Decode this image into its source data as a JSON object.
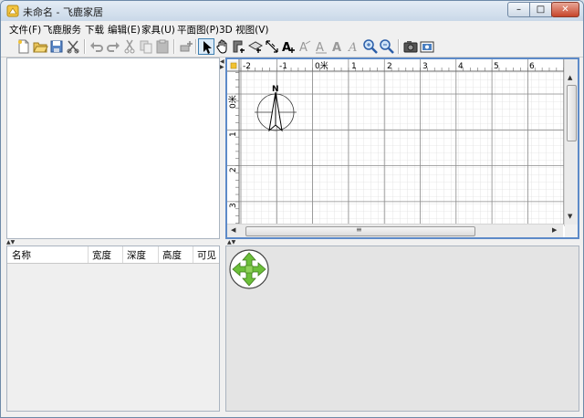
{
  "window": {
    "title": "未命名 - 飞鹿家居",
    "controls": {
      "minimize": "–",
      "maximize": "□",
      "close": "✕"
    }
  },
  "menu": [
    "文件(F)",
    "飞鹿服务",
    "下载",
    "编辑(E)",
    "家具(U)",
    "平面图(P)",
    "3D 视图(V)"
  ],
  "toolbar": {
    "icons": [
      "new-file-icon",
      "open-folder-icon",
      "save-icon",
      "cut-tools-icon",
      "undo-icon",
      "redo-icon",
      "cut-icon",
      "copy-icon",
      "paste-icon",
      "add-furniture-icon",
      "select-arrow-icon",
      "pan-hand-icon",
      "create-walls-icon",
      "create-rooms-icon",
      "create-dimensions-icon",
      "add-text-icon",
      "text-style-1-icon",
      "text-style-2-icon",
      "bold-text-icon",
      "italic-text-icon",
      "zoom-in-icon",
      "zoom-out-icon",
      "photo-camera-icon",
      "video-icon"
    ],
    "active": "select-arrow-icon"
  },
  "plan": {
    "x_ticks": [
      "-2",
      "-1",
      "0米",
      "1",
      "2",
      "3",
      "4",
      "5",
      "6"
    ],
    "y_ticks": [
      "0米",
      "1",
      "2",
      "3"
    ],
    "compass_label": "N",
    "hscroll_grip": "≡"
  },
  "furniture_table": {
    "columns": [
      "名称",
      "宽度",
      "深度",
      "高度",
      "可见"
    ]
  },
  "colors": {
    "plan_border": "#5d8ac8",
    "grid_minor": "#d6d6d6",
    "grid_major": "#8a8a8a",
    "nav_green": "#6cbf3a"
  }
}
